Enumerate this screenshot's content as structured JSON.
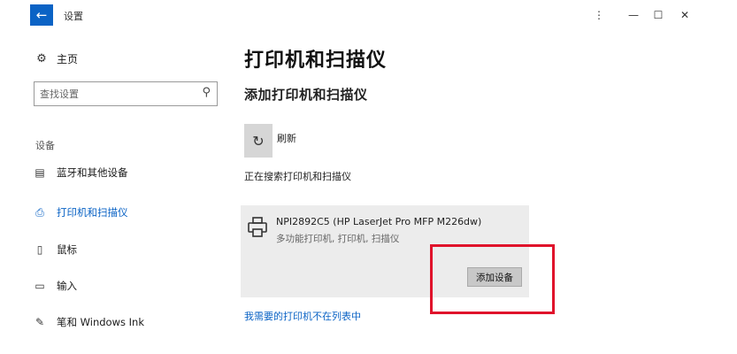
{
  "window": {
    "back_glyph": "←",
    "title": "设置",
    "controls": {
      "extra": "⋮",
      "minimize": "—",
      "maximize": "☐",
      "close": "✕"
    }
  },
  "sidebar": {
    "home_label": "主页",
    "search_placeholder": "查找设置",
    "section_label": "设备",
    "items": [
      {
        "label": "蓝牙和其他设备",
        "icon": "bluetooth-devices-icon",
        "active": false
      },
      {
        "label": "打印机和扫描仪",
        "icon": "printer-icon",
        "active": true
      },
      {
        "label": "鼠标",
        "icon": "mouse-icon",
        "active": false
      },
      {
        "label": "输入",
        "icon": "keyboard-icon",
        "active": false
      },
      {
        "label": "笔和 Windows Ink",
        "icon": "pen-icon",
        "active": false
      }
    ]
  },
  "main": {
    "title": "打印机和扫描仪",
    "add_heading": "添加打印机和扫描仪",
    "refresh_label": "刷新",
    "searching_text": "正在搜索打印机和扫描仪",
    "device": {
      "name": "NPI2892C5 (HP LaserJet Pro MFP M226dw)",
      "type": "多功能打印机, 打印机, 扫描仪"
    },
    "add_device_label": "添加设备",
    "missing_link": "我需要的打印机不在列表中"
  },
  "colors": {
    "accent": "#0b63c5",
    "highlight": "#e0132b",
    "panel": "#ececec"
  }
}
